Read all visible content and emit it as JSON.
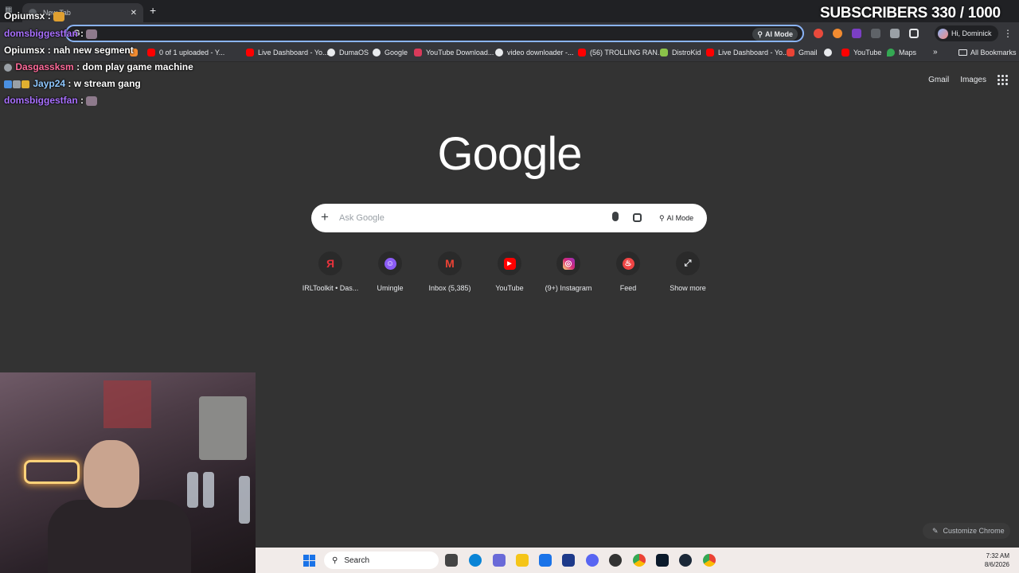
{
  "stream": {
    "subscribers_text": "SUBSCRIBERS 330 / 1000",
    "chat": [
      {
        "user": "Opiumsx",
        "message": "",
        "color": "white",
        "has_emote": true
      },
      {
        "user": "domsbiggestfan",
        "message": "",
        "color": "purple",
        "has_emote": true
      },
      {
        "user": "Opiumsx",
        "message": "nah new segment",
        "color": "white",
        "has_emote": false
      },
      {
        "user": "Dasgassksm",
        "message": "dom play game machine",
        "color": "pink",
        "has_emote": false
      },
      {
        "user": "Jayp24",
        "message": "w stream gang",
        "color": "blue",
        "has_emote": false
      },
      {
        "user": "domsbiggestfan",
        "message": "",
        "color": "purple",
        "has_emote": true
      }
    ]
  },
  "browser": {
    "tab_title": "New Tab",
    "omnibox_ai_label": "AI Mode",
    "profile_label": "Hi, Dominick",
    "bookmarks": [
      {
        "label": "0 of 1 uploaded - Y...",
        "icon": "youtube-icon"
      },
      {
        "label": "Live Dashboard - Yo...",
        "icon": "youtube-icon"
      },
      {
        "label": "DumaOS",
        "icon": "globe-icon"
      },
      {
        "label": "Google",
        "icon": "google-icon"
      },
      {
        "label": "YouTube Download...",
        "icon": "download-icon"
      },
      {
        "label": "video downloader -...",
        "icon": "google-icon"
      },
      {
        "label": "(56) TROLLING RAN...",
        "icon": "youtube-icon"
      },
      {
        "label": "DistroKid",
        "icon": "distrokid-icon"
      },
      {
        "label": "Live Dashboard - Yo...",
        "icon": "youtube-icon"
      },
      {
        "label": "Gmail",
        "icon": "gmail-icon"
      },
      {
        "label": "YouTube",
        "icon": "youtube-icon"
      },
      {
        "label": "Maps",
        "icon": "maps-icon"
      }
    ],
    "all_bookmarks_label": "All Bookmarks"
  },
  "ntp": {
    "gmail_link": "Gmail",
    "images_link": "Images",
    "logo_text": "Google",
    "search_placeholder": "Ask Google",
    "ai_mode_label": "AI Mode",
    "shortcuts": [
      {
        "label": "IRLToolkit • Das...",
        "icon": "irltoolkit-icon",
        "color": "#e8323c",
        "glyph": "Я"
      },
      {
        "label": "Umingle",
        "icon": "umingle-icon",
        "color": "#8b5cf6",
        "glyph": "☺"
      },
      {
        "label": "Inbox (5,385)",
        "icon": "gmail-icon",
        "color": "#ea4335",
        "glyph": "M"
      },
      {
        "label": "YouTube",
        "icon": "youtube-icon",
        "color": "#ff0000",
        "glyph": "▶"
      },
      {
        "label": "(9+) Instagram",
        "icon": "instagram-icon",
        "color": "#d62976",
        "glyph": "◎"
      },
      {
        "label": "Feed",
        "icon": "feed-icon",
        "color": "#ef4444",
        "glyph": "♨"
      },
      {
        "label": "Show more",
        "icon": "expand-icon",
        "color": "#2a2a2a",
        "glyph": "⤢"
      }
    ],
    "customize_label": "Customize Chrome"
  },
  "taskbar": {
    "search_label": "Search",
    "time": "7:32 AM",
    "date": "8/6/2026"
  }
}
